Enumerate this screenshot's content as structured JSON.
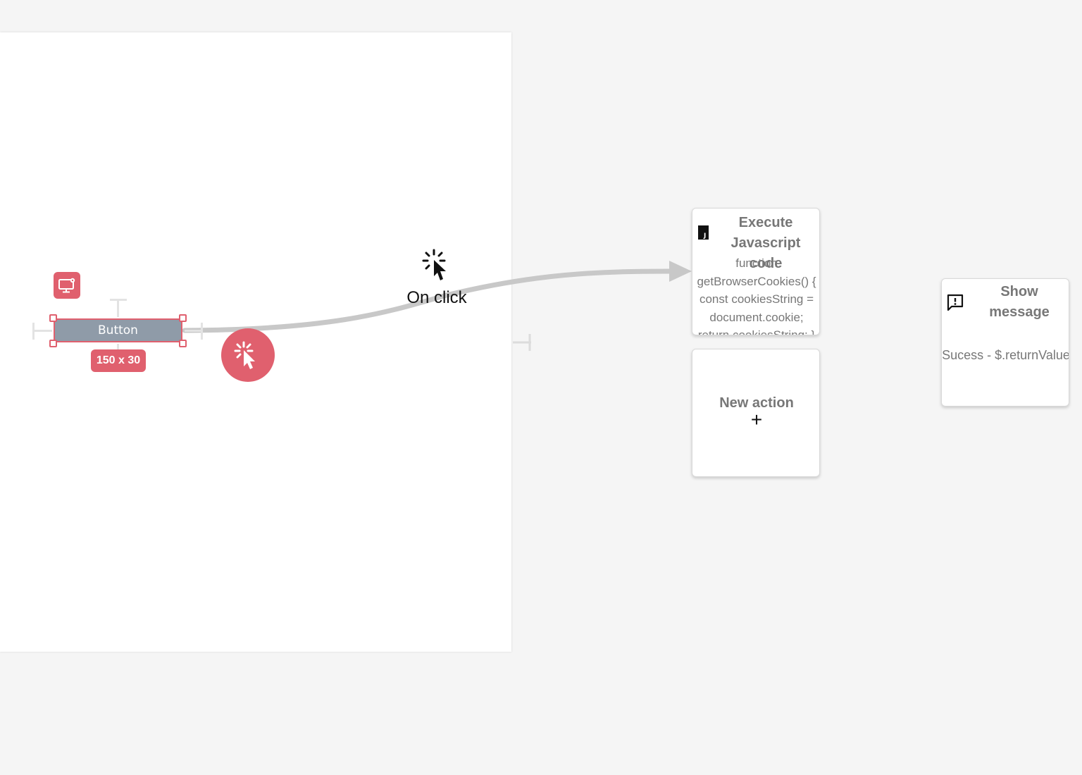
{
  "canvas": {
    "element": {
      "label": "Button",
      "size_label": "150 x 30"
    },
    "screen_badge_icon": "screen-settings-icon",
    "trigger_icon": "cursor-click-icon"
  },
  "flow": {
    "trigger": {
      "label": "On click",
      "icon": "cursor-click-icon"
    }
  },
  "actions": {
    "execute_js": {
      "icon": "js-file-icon",
      "title": "Execute Javascript code",
      "code": "function getBrowserCookies() { const cookiesString = document.cookie; return cookiesString; }"
    },
    "new_action": {
      "title": "New action",
      "plus": "+"
    },
    "show_message": {
      "icon": "message-alert-icon",
      "title": "Show message",
      "message": "Sucess - $.returnValue"
    }
  },
  "colors": {
    "accent": "#e0606e",
    "element_fill": "#8f9ba8",
    "connector": "#c8c8c8",
    "background": "#f5f5f5"
  }
}
